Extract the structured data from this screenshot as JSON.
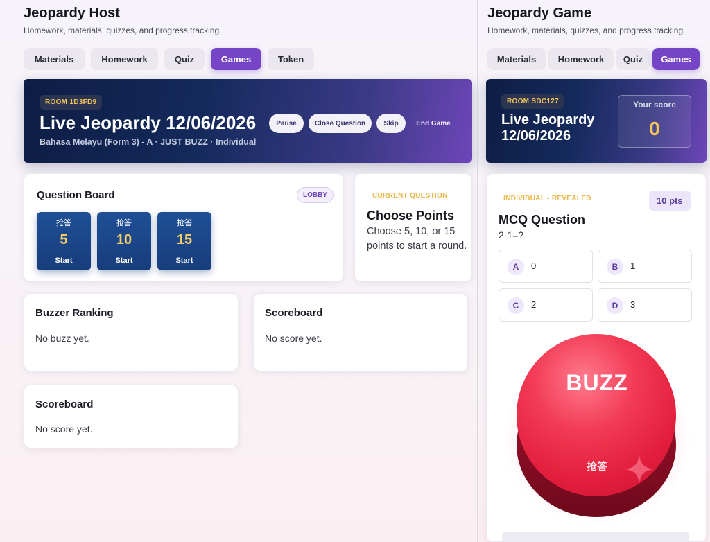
{
  "host": {
    "title": "Jeopardy Host",
    "subtitle": "Homework, materials, quizzes, and progress tracking.",
    "tabs": [
      {
        "label": "Materials"
      },
      {
        "label": "Homework"
      },
      {
        "label": "Quiz"
      },
      {
        "label": "Games",
        "active": true
      },
      {
        "label": "Token"
      }
    ],
    "hero": {
      "room": "ROOM 1D3FD9",
      "title": "Live Jeopardy 12/06/2026",
      "subtitle": "Bahasa Melayu (Form 3) - A · JUST BUZZ · Individual",
      "controls": {
        "pause": "Pause",
        "close": "Close Question",
        "skip": "Skip",
        "end": "End Game"
      }
    },
    "board": {
      "title": "Question Board",
      "status": "LOBBY",
      "tiles": [
        {
          "cn": "抢答",
          "points": "5",
          "action": "Start"
        },
        {
          "cn": "抢答",
          "points": "10",
          "action": "Start"
        },
        {
          "cn": "抢答",
          "points": "15",
          "action": "Start"
        }
      ]
    },
    "current": {
      "label": "CURRENT QUESTION",
      "title": "Choose Points",
      "text": "Choose 5, 10, or 15 points to start a round."
    },
    "buzzer": {
      "title": "Buzzer Ranking",
      "empty": "No buzz yet."
    },
    "scoreboard1": {
      "title": "Scoreboard",
      "empty": "No score yet."
    },
    "scoreboard2": {
      "title": "Scoreboard",
      "empty": "No score yet."
    }
  },
  "player": {
    "title": "Jeopardy Game",
    "subtitle": "Homework, materials, quizzes, and progress tracking.",
    "tabs": [
      {
        "label": "Materials"
      },
      {
        "label": "Homework"
      },
      {
        "label": "Quiz"
      },
      {
        "label": "Games",
        "active": true
      }
    ],
    "hero": {
      "room": "ROOM SDC127",
      "title_line1": "Live Jeopardy",
      "title_line2": "12/06/2026",
      "score_label": "Your score",
      "score": "0"
    },
    "question": {
      "status": "INDIVIDUAL - REVEALED",
      "points": "10 pts",
      "title": "MCQ Question",
      "prompt": "2-1=?",
      "options": [
        {
          "letter": "A",
          "text": "0"
        },
        {
          "letter": "B",
          "text": "1"
        },
        {
          "letter": "C",
          "text": "2"
        },
        {
          "letter": "D",
          "text": "3"
        }
      ]
    },
    "buzz": {
      "label": "BUZZ",
      "cn": "抢答"
    }
  },
  "colors": {
    "accent": "#7645c7",
    "gold": "#f1c55a",
    "buzz_red": "#e11d3c",
    "tile_blue": "#1f4f96"
  },
  "icons": {
    "sparkle": "sparkle-icon"
  }
}
